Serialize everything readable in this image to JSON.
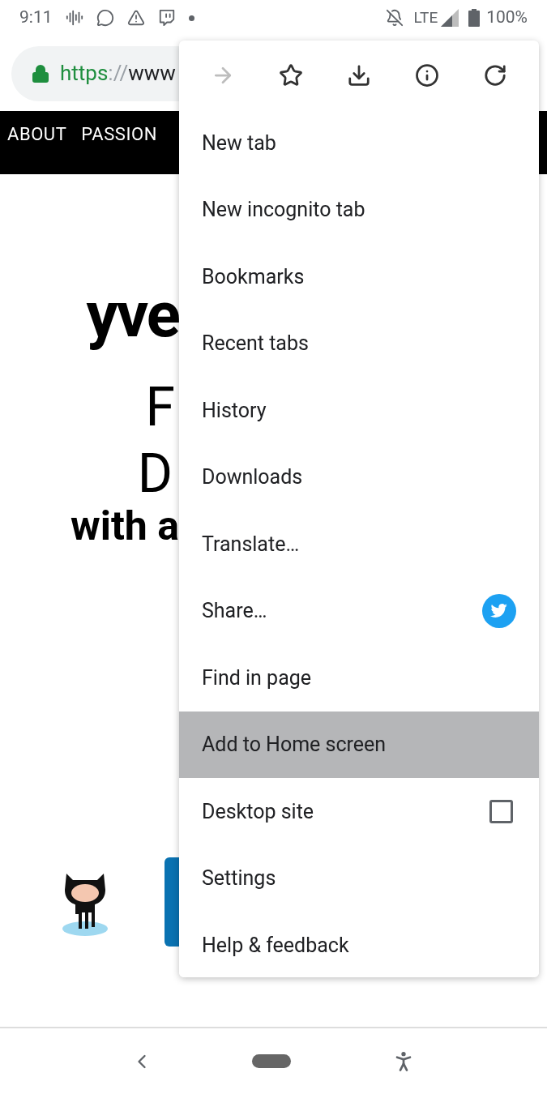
{
  "status_bar": {
    "time": "9:11",
    "network": "LTE",
    "battery": "100%"
  },
  "address_bar": {
    "scheme": "https",
    "separator": "://",
    "host": "www"
  },
  "site_nav": [
    "ABOUT",
    "PASSION"
  ],
  "page": {
    "name": "yve",
    "line_1": "F",
    "line_2": "D",
    "line_3": "with a"
  },
  "menu": {
    "toolbar": [
      {
        "kind": "forward",
        "disabled": true
      },
      {
        "kind": "bookmark",
        "disabled": false
      },
      {
        "kind": "download",
        "disabled": false
      },
      {
        "kind": "info",
        "disabled": false
      },
      {
        "kind": "reload",
        "disabled": false
      }
    ],
    "items": [
      {
        "label": "New tab",
        "kind": "plain",
        "selected": false
      },
      {
        "label": "New incognito tab",
        "kind": "plain",
        "selected": false
      },
      {
        "label": "Bookmarks",
        "kind": "plain",
        "selected": false
      },
      {
        "label": "Recent tabs",
        "kind": "plain",
        "selected": false
      },
      {
        "label": "History",
        "kind": "plain",
        "selected": false
      },
      {
        "label": "Downloads",
        "kind": "plain",
        "selected": false
      },
      {
        "label": "Translate…",
        "kind": "plain",
        "selected": false
      },
      {
        "label": "Share…",
        "kind": "share",
        "selected": false
      },
      {
        "label": "Find in page",
        "kind": "plain",
        "selected": false
      },
      {
        "label": "Add to Home screen",
        "kind": "plain",
        "selected": true
      },
      {
        "label": "Desktop site",
        "kind": "checkbox",
        "checked": false,
        "selected": false
      },
      {
        "label": "Settings",
        "kind": "plain",
        "selected": false
      },
      {
        "label": "Help & feedback",
        "kind": "plain",
        "selected": false
      }
    ]
  }
}
